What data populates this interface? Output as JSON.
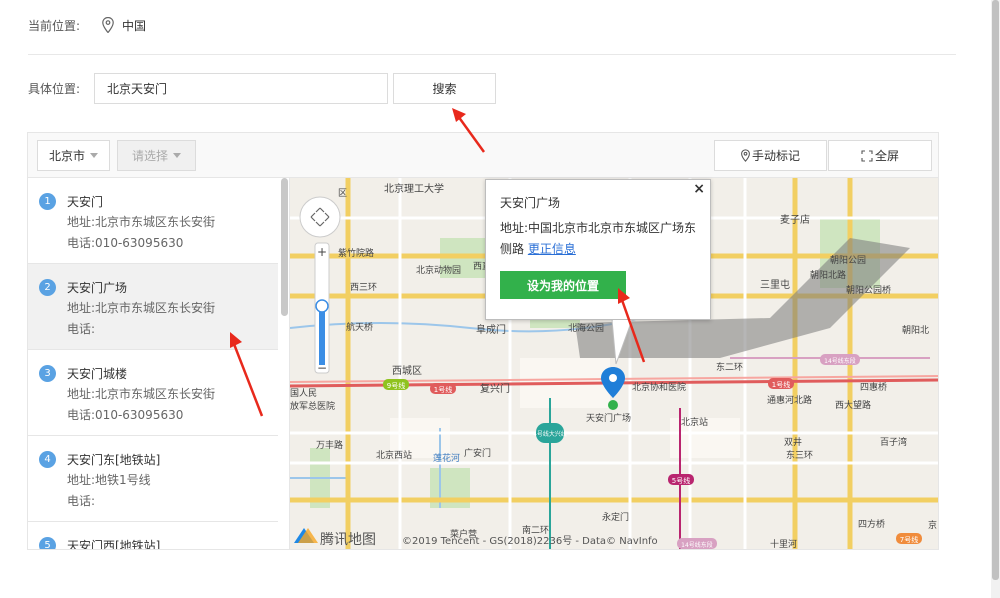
{
  "location": {
    "label": "当前位置:",
    "value": "中国"
  },
  "search": {
    "label": "具体位置:",
    "value": "北京天安门",
    "button": "搜索"
  },
  "toolbar": {
    "city": "北京市",
    "district_placeholder": "请选择",
    "mark_button": "手动标记",
    "fullscreen_button": "全屏"
  },
  "results": [
    {
      "num": "1",
      "name": "天安门",
      "address": "地址:北京市东城区东长安街",
      "phone": "电话:010-63095630",
      "active": false
    },
    {
      "num": "2",
      "name": "天安门广场",
      "address": "地址:北京市东城区东长安街",
      "phone": "电话:",
      "active": true
    },
    {
      "num": "3",
      "name": "天安门城楼",
      "address": "地址:北京市东城区东长安街",
      "phone": "电话:010-63095630",
      "active": false
    },
    {
      "num": "4",
      "name": "天安门东[地铁站]",
      "address": "地址:地铁1号线",
      "phone": "电话:",
      "active": false
    },
    {
      "num": "5",
      "name": "天安门西[地铁站]",
      "address": "",
      "phone": "",
      "active": false
    }
  ],
  "popup": {
    "title": "天安门广场",
    "address": "地址:中国北京市北京市东城区广场东侧路",
    "link": "更正信息",
    "button": "设为我的位置",
    "close": "×"
  },
  "map": {
    "labels": {
      "lbl_bit": "北京理工大学",
      "lbl_zoo": "北京动物园",
      "lbl_xizhimen": "西直门",
      "lbl_maizidian": "麦子店",
      "lbl_chaoyang_park": "朝阳公园",
      "lbl_sanlitun": "三里屯",
      "lbl_chaoyang_bridge": "朝阳公园桥",
      "lbl_hangtian": "航天桥",
      "lbl_fuchengmen": "阜成门",
      "lbl_beihai": "北海公园",
      "lbl_chaoyangbei": "朝阳北",
      "lbl_xicheng": "西城区",
      "lbl_fuxingmen": "复兴门",
      "lbl_xiehe": "北京协和医院",
      "lbl_sihuiqiao": "四惠桥",
      "lbl_tongweihe": "通惠河北路",
      "lbl_tiananmen": "天安门广场",
      "lbl_bjzhan": "北京站",
      "lbl_bjxizhan": "北京西站",
      "lbl_guanganmen": "广安门",
      "lbl_shuangjing": "双井",
      "lbl_baiziwan": "百子湾",
      "lbl_yongdingmen": "永定门",
      "lbl_sifangqiao": "四方桥",
      "lbl_shilihe": "十里河",
      "lbl_caihuying": "菜户营",
      "lbl_nanerhuan": "南二环",
      "lbl_military": "放军总医院",
      "lbl_renmin": "国人民",
      "lbl_district": "区",
      "lbl_jing": "京",
      "lbl_dongsanhuan": "东三环",
      "lbl_xisanhuan": "西三环",
      "lbl_fengtailu": "万丰路",
      "lbl_lianhuahe": "莲花河",
      "lbl_dawanglu": "西大望路",
      "lbl_ziwei": "紫竹院路",
      "lbl_line1_a": "1号线",
      "lbl_line1_b": "1号线",
      "lbl_line9": "9号线",
      "lbl_line4": "4号线大兴线",
      "lbl_line5": "5号线",
      "lbl_line14a": "14号线东段",
      "lbl_line14b": "14号线东段",
      "lbl_line7": "7号线",
      "lbl_road_east": "东二环",
      "lbl_tc": "朝阳北路",
      "lbl_logo": "腾讯地图",
      "lbl_copyright": "©2019 Tencent - GS(2018)2236号 - Data© NavInfo"
    }
  },
  "colors": {
    "green": "#32b14b",
    "badge_blue": "#5aa2e3",
    "arrow_red": "#e8291c",
    "link": "#2a6fd6"
  }
}
